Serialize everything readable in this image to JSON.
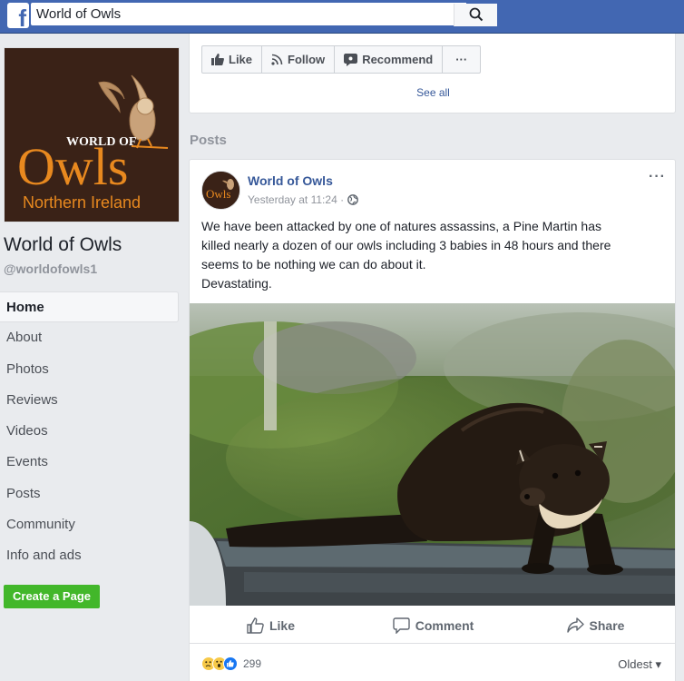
{
  "topbar": {
    "logo_letter": "f",
    "search": {
      "value": "World of Owls"
    }
  },
  "page": {
    "logo": {
      "title_top": "WORLD OF",
      "title_main": "Owls",
      "subtitle": "Northern Ireland"
    },
    "name": "World of Owls",
    "handle": "@worldofowls1"
  },
  "nav": {
    "items": [
      {
        "label": "Home"
      },
      {
        "label": "About"
      },
      {
        "label": "Photos"
      },
      {
        "label": "Reviews"
      },
      {
        "label": "Videos"
      },
      {
        "label": "Events"
      },
      {
        "label": "Posts"
      },
      {
        "label": "Community"
      },
      {
        "label": "Info and ads"
      }
    ],
    "create_page": "Create a Page"
  },
  "page_actions": {
    "like": "Like",
    "follow": "Follow",
    "recommend": "Recommend",
    "more": "···",
    "see_all": "See all"
  },
  "posts_section": {
    "label": "Posts"
  },
  "post": {
    "author": "World of Owls",
    "timestamp": "Yesterday at 11:24 ·",
    "more": "···",
    "text_lines": [
      "We have been attacked by one of natures assassins, a Pine Martin has",
      "killed nearly a dozen of our owls including 3 babies in 48 hours and there",
      "seems to be nothing we can do about it.",
      "Devastating."
    ],
    "actions": {
      "like": "Like",
      "comment": "Comment",
      "share": "Share"
    },
    "reactions": {
      "count": "299",
      "types": [
        "sad",
        "wow",
        "like"
      ]
    },
    "sort": "Oldest ▾"
  },
  "colors": {
    "brand": "#4267b2",
    "link": "#365899",
    "create_button": "#42b72a",
    "logo_orange": "#e8891f",
    "logo_bg": "#3a2217"
  }
}
